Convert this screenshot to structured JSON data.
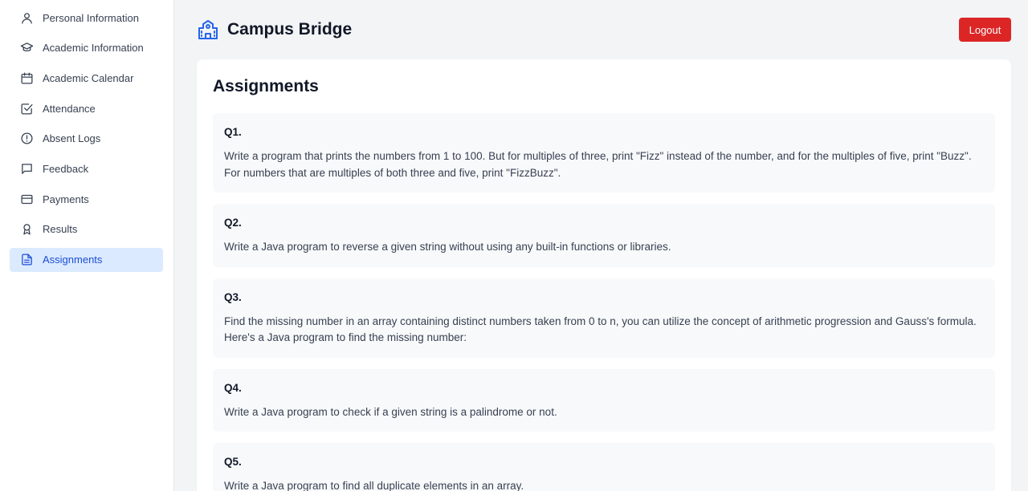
{
  "sidebar": {
    "items": [
      {
        "label": "Personal Information",
        "icon": "user-icon"
      },
      {
        "label": "Academic Information",
        "icon": "graduation-cap-icon"
      },
      {
        "label": "Academic Calendar",
        "icon": "calendar-icon"
      },
      {
        "label": "Attendance",
        "icon": "checkbox-icon"
      },
      {
        "label": "Absent Logs",
        "icon": "alert-circle-icon"
      },
      {
        "label": "Feedback",
        "icon": "message-icon"
      },
      {
        "label": "Payments",
        "icon": "credit-card-icon"
      },
      {
        "label": "Results",
        "icon": "award-icon"
      },
      {
        "label": "Assignments",
        "icon": "file-text-icon",
        "active": true
      }
    ]
  },
  "header": {
    "app_title": "Campus Bridge",
    "logout_label": "Logout"
  },
  "page": {
    "title": "Assignments",
    "questions": [
      {
        "num": "Q1.",
        "text": "Write a program that prints the numbers from 1 to 100. But for multiples of three, print \"Fizz\" instead of the number, and for the multiples of five, print \"Buzz\". For numbers that are multiples of both three and five, print \"FizzBuzz\"."
      },
      {
        "num": "Q2.",
        "text": "Write a Java program to reverse a given string without using any built-in functions or libraries."
      },
      {
        "num": "Q3.",
        "text": "Find the missing number in an array containing distinct numbers taken from 0 to n, you can utilize the concept of arithmetic progression and Gauss's formula. Here's a Java program to find the missing number:"
      },
      {
        "num": "Q4.",
        "text": "Write a Java program to check if a given string is a palindrome or not."
      },
      {
        "num": "Q5.",
        "text": "Write a Java program to find all duplicate elements in an array."
      }
    ]
  },
  "colors": {
    "accent": "#2563eb",
    "active_bg": "#dbeafe",
    "logout": "#dc2626"
  }
}
